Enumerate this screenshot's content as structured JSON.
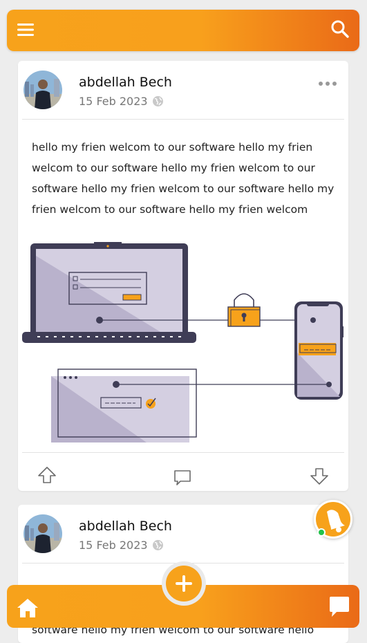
{
  "header": {
    "menu_icon": "hamburger-menu-icon",
    "search_icon": "search-icon",
    "accent_start": "#f7a21b",
    "accent_end": "#ea6a17"
  },
  "posts": [
    {
      "author": "abdellah Bech",
      "date": "15 Feb 2023",
      "visibility_icon": "globe-icon",
      "text": "hello my frien welcom to our software hello my frien welcom to our software hello my frien welcom to our software hello my frien welcom to our software hello my frien welcom to our software hello my frien welcom",
      "actions": {
        "upvote_icon": "arrow-up-icon",
        "comment_icon": "comment-icon",
        "downvote_icon": "arrow-down-icon"
      }
    },
    {
      "author": "abdellah Bech",
      "date": "15 Feb 2023",
      "visibility_icon": "globe-icon",
      "text_visible": "software hello my frien welcom to our software hello"
    }
  ],
  "floating": {
    "bell_icon": "bell-icon",
    "status": "online",
    "status_color": "#22c24a"
  },
  "bottom_nav": {
    "home_icon": "home-icon",
    "add_icon": "plus-icon",
    "chat_icon": "chat-icon"
  }
}
